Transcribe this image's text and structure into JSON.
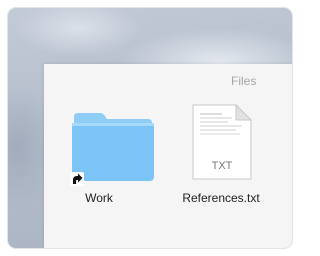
{
  "window": {
    "title": "Files"
  },
  "items": [
    {
      "label": "Work",
      "icon": "folder-icon",
      "alias": true,
      "color": "#7cc4f5"
    },
    {
      "label": "References.txt",
      "icon": "text-document-icon",
      "badge": "TXT"
    }
  ],
  "colors": {
    "folder_body": "#7cc4f5",
    "folder_tab": "#8fcdf7",
    "window_bg": "#f5f5f5",
    "title_text": "#a6a6a6"
  }
}
